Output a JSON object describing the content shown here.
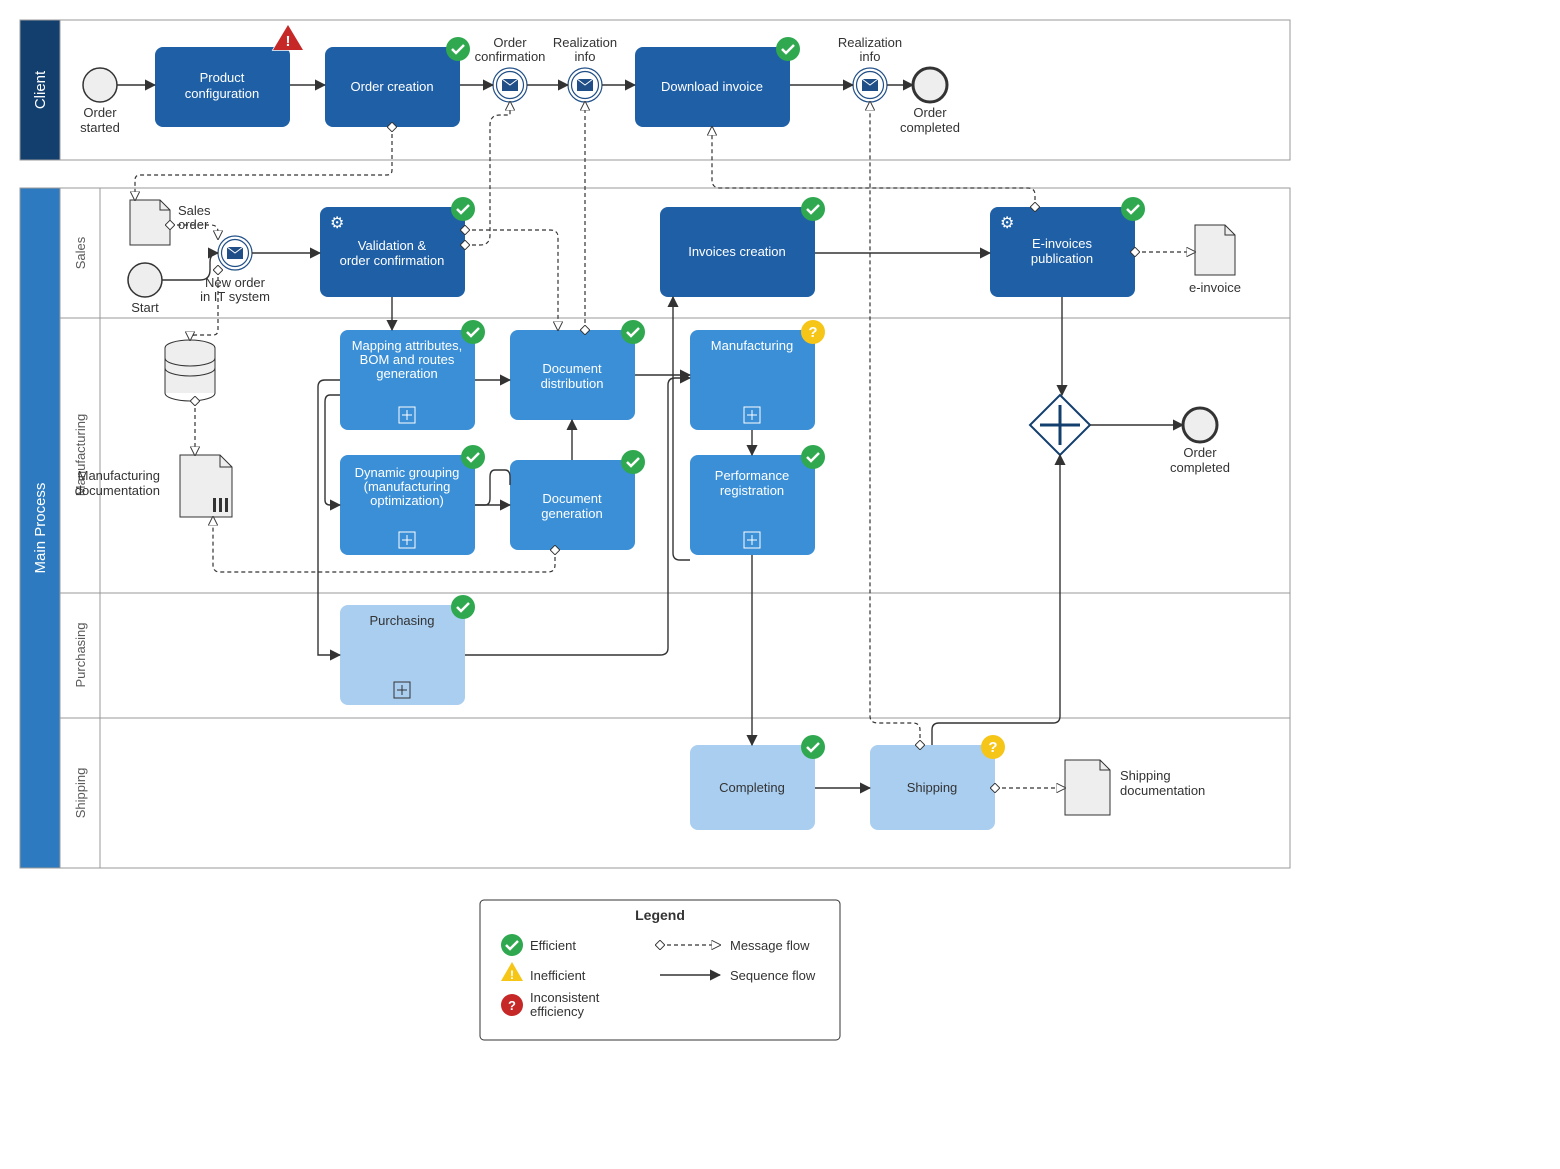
{
  "pools": {
    "client": "Client",
    "main": "Main Process"
  },
  "lanes": {
    "sales": "Sales",
    "manufacturing": "Manufacturing",
    "purchasing": "Purchasing",
    "shipping": "Shipping"
  },
  "tasks": {
    "product_config": "Product\nconfiguration",
    "order_creation": "Order creation",
    "download_invoice": "Download invoice",
    "validation": "Validation &\norder confirmation",
    "invoices_creation": "Invoices creation",
    "einvoices_pub": "E-invoices\npublication",
    "mapping": "Mapping attributes,\nBOM and routes\ngeneration",
    "dynamic_grouping": "Dynamic grouping\n(manufacturing\noptimization)",
    "doc_distribution": "Document\ndistribution",
    "doc_generation": "Document\ngeneration",
    "manufacturing_task": "Manufacturing",
    "performance_reg": "Performance\nregistration",
    "purchasing_task": "Purchasing",
    "completing": "Completing",
    "shipping_task": "Shipping"
  },
  "events": {
    "order_started": "Order\nstarted",
    "order_confirmation": "Order\nconfirmation",
    "realization_info1": "Realization\ninfo",
    "realization_info2": "Realization\ninfo",
    "order_completed": "Order\ncompleted",
    "start": "Start",
    "new_order": "New order\nin IT system",
    "order_completed2": "Order\ncompleted"
  },
  "data": {
    "sales_order": "Sales\norder",
    "mfg_doc": "Manufacturing\ndocumentation",
    "einvoice": "e-invoice",
    "shipping_doc": "Shipping\ndocumentation"
  },
  "legend": {
    "title": "Legend",
    "efficient": "Efficient",
    "inefficient": "Inefficient",
    "inconsistent": "Inconsistent\nefficiency",
    "msg_flow": "Message flow",
    "seq_flow": "Sequence flow"
  },
  "colors": {
    "dark_blue": "#1e5fa5",
    "med_blue": "#3a8fd6",
    "light_blue": "#a9cef0",
    "green": "#2fa84f",
    "yellow": "#f5c518",
    "red": "#c62828",
    "border": "#999",
    "pool_dark": "#133f6e",
    "pool_med": "#2e7ac0"
  }
}
